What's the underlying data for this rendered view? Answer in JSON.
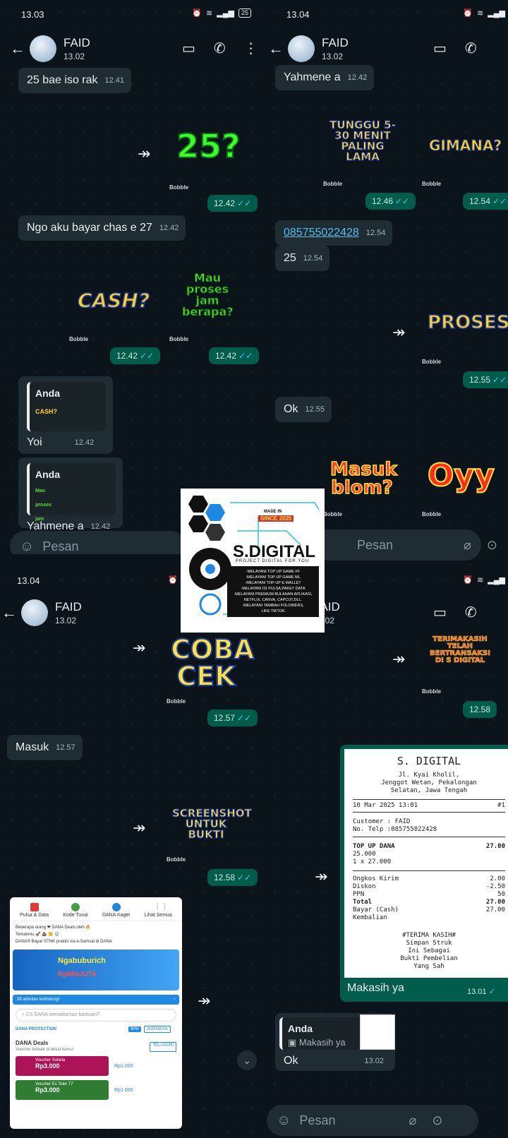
{
  "status": {
    "tl": "13.03",
    "tr": "13.04",
    "bl": "13.04",
    "battery": "25"
  },
  "contact": {
    "name": "FAID",
    "time": "13.02"
  },
  "p1": {
    "m1": {
      "text": "25 bae iso rak",
      "time": "12.41"
    },
    "s1": "25?",
    "s1_label": "Bobble",
    "t1": "12.42",
    "m2": {
      "text": "Ngo aku bayar chas e 27",
      "time": "12.42"
    },
    "s2": "CASH?",
    "s2_label": "Bobble",
    "s3": "Mau proses jam berapa?",
    "s3_label": "Bobble",
    "t2": "12.42",
    "t3": "12.42",
    "q1": {
      "author": "Anda",
      "sticker": "CASH?",
      "text": "Yoi",
      "time": "12.42"
    },
    "q2": {
      "author": "Anda",
      "sticker": "Mau proses jam berapa?",
      "text": "Yahmene a",
      "time": "12.42"
    },
    "input": "Pesan"
  },
  "p2": {
    "m1": {
      "text": "Yahmene a",
      "time": "12.42"
    },
    "s1": "TUNGGU 5-30 MENIT PALING LAMA",
    "s1_label": "Bobble",
    "s2": "GIMANA?",
    "s2_label": "Bobble",
    "t1": "12.46",
    "t2": "12.54",
    "phone": {
      "text": "085755022428",
      "time": "12.54"
    },
    "m2": {
      "text": "25",
      "time": "12.54"
    },
    "s3": "PROSES",
    "s3_label": "Bobble",
    "t3": "12.55",
    "m3": {
      "text": "Ok",
      "time": "12.55"
    },
    "s4": "Masuk blom?",
    "s4_label": "Bobble",
    "s5": "Oyy",
    "s5_label": "Bobble",
    "input": "Pesan"
  },
  "p3": {
    "s1": "COBA CEK",
    "s1_label": "Bobble",
    "t1": "12.57",
    "m1": {
      "text": "Masuk",
      "time": "12.57"
    },
    "s2": "SCREENSHOT UNTUK BUKTI",
    "s2_label": "Bobble",
    "t2": "12.58",
    "dana": {
      "menu": [
        "Pulsa & Data",
        "Kode Tunai",
        "DANA Kaget",
        "Lihat Semua"
      ],
      "feed1": "Beberapa orang ❤ DANA Deals oleh 🔥",
      "feed2": "Temanmu 🚀 💩 🙂 😊",
      "feed3": "DANA® Bayar STNK praktis via e-Samsat di DANA",
      "banner": "Ngabuburich",
      "banner_sub": "Rp886JUTA",
      "protect": "38 aktivitas terlindungi!",
      "search": "CS DANA menawarkan bantuan?",
      "shield": "DANA PROTECTION",
      "pct": "80%",
      "aman": "AMANKAN",
      "deals": "DANA Deals",
      "deals_sub": "Voucher terbaik di dekat kamu!",
      "telusuri": "TELUSURI",
      "v1": {
        "name": "Voucher Solaria",
        "price": "Rp3.000",
        "orig": "Rp1.000",
        "off": "-66%"
      },
      "v2": {
        "name": "Voucher Es Teler 77",
        "price": "Rp3.000",
        "orig": "Rp1.000",
        "off": "-66%"
      }
    }
  },
  "p4": {
    "s1": "TERIMAKASIH TELAH BERTRANSAKSI DI S DIGITAL",
    "s1_label": "Bobble",
    "t1": "12.58",
    "receipt": {
      "title": "S. DIGITAL",
      "addr1": "Jl. Kyai Kholil,",
      "addr2": "Jenggot Wetan, Pekalongan",
      "addr3": "Selatan, Jawa Tengah",
      "date": "10 Mar 2025 13:01",
      "hash": "#1",
      "cust": "Customer : FAID",
      "telp": "No. Telp :085755022428",
      "item": "TOP UP DANA",
      "item_amt": "27.00",
      "qty1": "25.000",
      "qty2": "1 x 27.000",
      "ongkos": "Ongkos Kirim",
      "ongkos_v": "2.00",
      "diskon": "Diskon",
      "diskon_v": "-2.50",
      "ppn": "PPN",
      "ppn_v": "50",
      "total": "Total",
      "total_v": "27.00",
      "bayar": "Bayar (Cash)",
      "bayar_v": "27.00",
      "kembali": "Kembalian",
      "thanks1": "#TERIMA KASIH#",
      "thanks2": "Simpan Struk",
      "thanks3": "Ini Sebagai",
      "thanks4": "Bukti Pembelian",
      "thanks5": "Yang Sah"
    },
    "caption": {
      "text": "Makasih ya",
      "time": "13.01"
    },
    "reply": {
      "author": "Anda",
      "quote": "Makasih ya",
      "text": "Ok",
      "time": "13.02"
    },
    "input": "Pesan"
  },
  "promo": {
    "made": "MADE IN",
    "since": "SINCE 2025",
    "brand": "S.DIGITAL",
    "tag": "PROJECT DIGITAL FOR YOU",
    "lines": [
      "-MELAYANI TOP UP GAME FF",
      "-MELAYANI TOP UP GAME ML",
      "-MELAYANI TOP UP E-WALLET",
      "-MELAYANI ISI PULSA,PAKET DATA",
      "-MELAYANI PREMIUM BULANAN APLIKASI,",
      "NETFLIX, CANVA, CAPCUT,DLL.",
      "-MELAYANI TAMBAH FOLOWERS,",
      "LIKE TIKTOK"
    ]
  },
  "colors": {
    "bg": "#0b141a",
    "incoming": "#202c33",
    "outgoing": "#005c4b",
    "tick": "#53bdeb"
  }
}
